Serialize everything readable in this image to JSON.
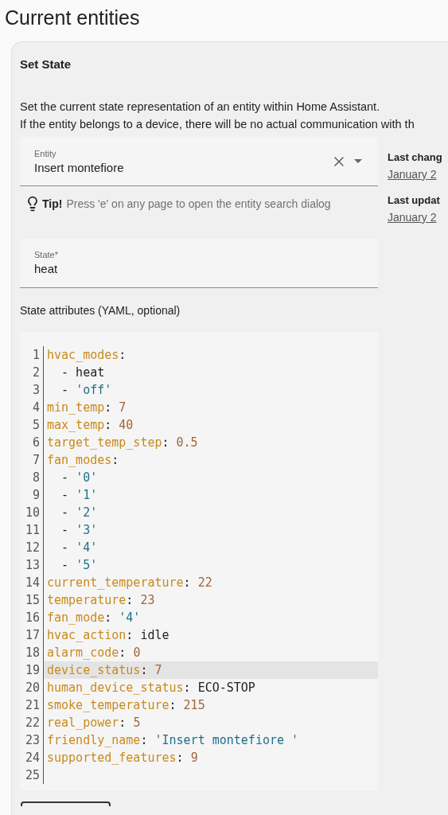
{
  "page_title": "Current entities",
  "card": {
    "title": "Set State",
    "description": [
      "Set the current state representation of an entity within Home Assistant.",
      "If the entity belongs to a device, there will be no actual communication with th"
    ],
    "entity_field": {
      "label": "Entity",
      "value": "Insert montefiore"
    },
    "tip": {
      "lead": "Tip!",
      "text": "Press 'e' on any page to open the entity search dialog"
    },
    "state_field": {
      "label": "State*",
      "value": "heat"
    },
    "attributes_label": "State attributes (YAML, optional)",
    "side": [
      {
        "label": "Last chang",
        "value": "January 2"
      },
      {
        "label": "Last updat",
        "value": "January 2"
      }
    ],
    "code_lines": [
      {
        "number": "1",
        "selected": false,
        "tokens": [
          {
            "kind": "key",
            "text": "hvac_modes"
          },
          {
            "kind": "punct",
            "text": ":"
          }
        ]
      },
      {
        "number": "2",
        "selected": false,
        "tokens": [
          {
            "kind": "plain",
            "text": "  - heat"
          }
        ]
      },
      {
        "number": "3",
        "selected": false,
        "tokens": [
          {
            "kind": "plain",
            "text": "  - "
          },
          {
            "kind": "string",
            "text": "'off'"
          }
        ]
      },
      {
        "number": "4",
        "selected": false,
        "tokens": [
          {
            "kind": "key",
            "text": "min_temp"
          },
          {
            "kind": "punct",
            "text": ": "
          },
          {
            "kind": "number",
            "text": "7"
          }
        ]
      },
      {
        "number": "5",
        "selected": false,
        "tokens": [
          {
            "kind": "key",
            "text": "max_temp"
          },
          {
            "kind": "punct",
            "text": ": "
          },
          {
            "kind": "number",
            "text": "40"
          }
        ]
      },
      {
        "number": "6",
        "selected": false,
        "tokens": [
          {
            "kind": "key",
            "text": "target_temp_step"
          },
          {
            "kind": "punct",
            "text": ": "
          },
          {
            "kind": "number",
            "text": "0.5"
          }
        ]
      },
      {
        "number": "7",
        "selected": false,
        "tokens": [
          {
            "kind": "key",
            "text": "fan_modes"
          },
          {
            "kind": "punct",
            "text": ":"
          }
        ]
      },
      {
        "number": "8",
        "selected": false,
        "tokens": [
          {
            "kind": "plain",
            "text": "  - "
          },
          {
            "kind": "string",
            "text": "'0'"
          }
        ]
      },
      {
        "number": "9",
        "selected": false,
        "tokens": [
          {
            "kind": "plain",
            "text": "  - "
          },
          {
            "kind": "string",
            "text": "'1'"
          }
        ]
      },
      {
        "number": "10",
        "selected": false,
        "tokens": [
          {
            "kind": "plain",
            "text": "  - "
          },
          {
            "kind": "string",
            "text": "'2'"
          }
        ]
      },
      {
        "number": "11",
        "selected": false,
        "tokens": [
          {
            "kind": "plain",
            "text": "  - "
          },
          {
            "kind": "string",
            "text": "'3'"
          }
        ]
      },
      {
        "number": "12",
        "selected": false,
        "tokens": [
          {
            "kind": "plain",
            "text": "  - "
          },
          {
            "kind": "string",
            "text": "'4'"
          }
        ]
      },
      {
        "number": "13",
        "selected": false,
        "tokens": [
          {
            "kind": "plain",
            "text": "  - "
          },
          {
            "kind": "string",
            "text": "'5'"
          }
        ]
      },
      {
        "number": "14",
        "selected": false,
        "tokens": [
          {
            "kind": "key",
            "text": "current_temperature"
          },
          {
            "kind": "punct",
            "text": ": "
          },
          {
            "kind": "number",
            "text": "22"
          }
        ]
      },
      {
        "number": "15",
        "selected": false,
        "tokens": [
          {
            "kind": "key",
            "text": "temperature"
          },
          {
            "kind": "punct",
            "text": ": "
          },
          {
            "kind": "number",
            "text": "23"
          }
        ]
      },
      {
        "number": "16",
        "selected": false,
        "tokens": [
          {
            "kind": "key",
            "text": "fan_mode"
          },
          {
            "kind": "punct",
            "text": ": "
          },
          {
            "kind": "string",
            "text": "'4'"
          }
        ]
      },
      {
        "number": "17",
        "selected": false,
        "tokens": [
          {
            "kind": "key",
            "text": "hvac_action"
          },
          {
            "kind": "punct",
            "text": ": "
          },
          {
            "kind": "plain",
            "text": "idle"
          }
        ]
      },
      {
        "number": "18",
        "selected": false,
        "tokens": [
          {
            "kind": "key",
            "text": "alarm_code"
          },
          {
            "kind": "punct",
            "text": ": "
          },
          {
            "kind": "number",
            "text": "0"
          }
        ]
      },
      {
        "number": "19",
        "selected": true,
        "tokens": [
          {
            "kind": "key",
            "text": "device_status"
          },
          {
            "kind": "punct",
            "text": ": "
          },
          {
            "kind": "number",
            "text": "7"
          }
        ]
      },
      {
        "number": "20",
        "selected": false,
        "tokens": [
          {
            "kind": "key",
            "text": "human_device_status"
          },
          {
            "kind": "punct",
            "text": ": "
          },
          {
            "kind": "plain",
            "text": "ECO-STOP"
          }
        ]
      },
      {
        "number": "21",
        "selected": false,
        "tokens": [
          {
            "kind": "key",
            "text": "smoke_temperature"
          },
          {
            "kind": "punct",
            "text": ": "
          },
          {
            "kind": "number",
            "text": "215"
          }
        ]
      },
      {
        "number": "22",
        "selected": false,
        "tokens": [
          {
            "kind": "key",
            "text": "real_power"
          },
          {
            "kind": "punct",
            "text": ": "
          },
          {
            "kind": "number",
            "text": "5"
          }
        ]
      },
      {
        "number": "23",
        "selected": false,
        "tokens": [
          {
            "kind": "key",
            "text": "friendly_name"
          },
          {
            "kind": "punct",
            "text": ": "
          },
          {
            "kind": "string",
            "text": "'Insert montefiore '"
          }
        ]
      },
      {
        "number": "24",
        "selected": false,
        "tokens": [
          {
            "kind": "key",
            "text": "supported_features"
          },
          {
            "kind": "punct",
            "text": ": "
          },
          {
            "kind": "number",
            "text": "9"
          }
        ]
      },
      {
        "number": "25",
        "selected": false
      }
    ]
  }
}
